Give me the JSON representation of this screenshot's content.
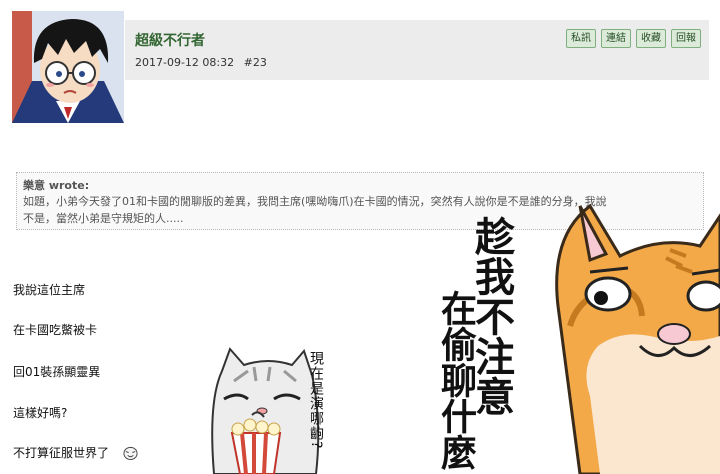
{
  "post": {
    "username": "超級不行者",
    "timestamp": "2017-09-12 08:32",
    "floor": "#23",
    "actions": [
      {
        "label": "私訊"
      },
      {
        "label": "連結"
      },
      {
        "label": "收藏"
      },
      {
        "label": "回報"
      }
    ]
  },
  "quote": {
    "author": "樂意 wrote:",
    "text": "如題，小弟今天發了01和卡國的閒聊版的差異，我問主席(嘿呦嗨爪)在卡國的情況，突然有人說你是不是誰的分身，我說不是，當然小弟是守規矩的人.....",
    "text_line1": "如題，小弟今天發了01和卡國的閒聊版的差異，我問主席(嘿呦嗨爪)在卡國的情況，突然有人說你是不是誰的分身，我說",
    "text_line2": "不是，當然小弟是守規矩的人....."
  },
  "body_lines": [
    "我說這位主席",
    "在卡國吃鱉被卡",
    "回01裝孫顯靈異",
    "這樣好嗎?",
    "不打算征服世界了"
  ],
  "stickers": {
    "small_text": "現在是演哪齣?",
    "big_text_1": "趁我不注意",
    "big_text_2": "在偷聊什麼"
  },
  "icons": {
    "avatar": "anime-boy-glasses-avatar",
    "smiley": "laughing-smiley-icon"
  },
  "colors": {
    "header_bg": "#ececec",
    "username": "#336633",
    "button_bg": "#dcebd9",
    "cat_orange": "#f0a040"
  }
}
